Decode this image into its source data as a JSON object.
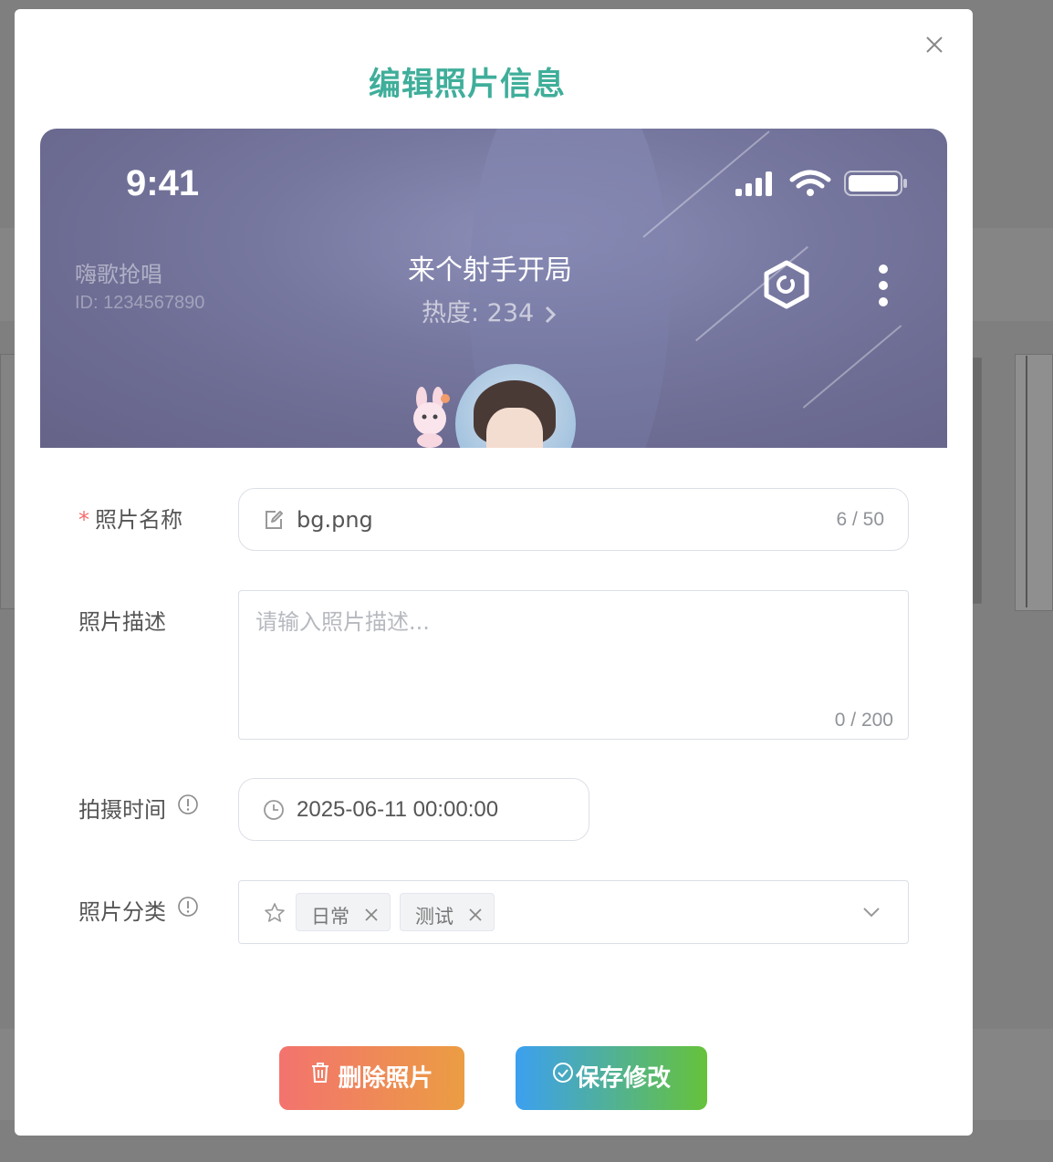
{
  "dialog": {
    "title": "编辑照片信息",
    "close_icon": "close-icon"
  },
  "preview": {
    "status_time": "9:41",
    "room_name": "嗨歌抢唱",
    "room_id": "ID: 1234567890",
    "song_title": "来个射手开局",
    "heat": "热度: 234",
    "heat_icon": "chevron-right-icon",
    "action_icons": [
      "hexagon-icon",
      "more-vertical-icon"
    ]
  },
  "form": {
    "name": {
      "required_mark": "*",
      "label": "照片名称",
      "value": "bg.png",
      "count": "6 / 50",
      "icon": "edit-icon"
    },
    "description": {
      "label": "照片描述",
      "placeholder": "请输入照片描述...",
      "count": "0 / 200"
    },
    "shoot_time": {
      "label": "拍摄时间",
      "value": "2025-06-11 00:00:00",
      "icon": "clock-icon"
    },
    "category": {
      "label": "照片分类",
      "tags": [
        "日常",
        "测试"
      ],
      "icon": "star-icon"
    }
  },
  "actions": {
    "delete_label": "删除照片",
    "save_label": "保存修改"
  },
  "colors": {
    "title": "#3fae9a",
    "required": "#f56c6c",
    "delete_gradient": [
      "#f3736e",
      "#eb9d43"
    ],
    "save_gradient": [
      "#3ca0f0",
      "#66c23a"
    ]
  }
}
